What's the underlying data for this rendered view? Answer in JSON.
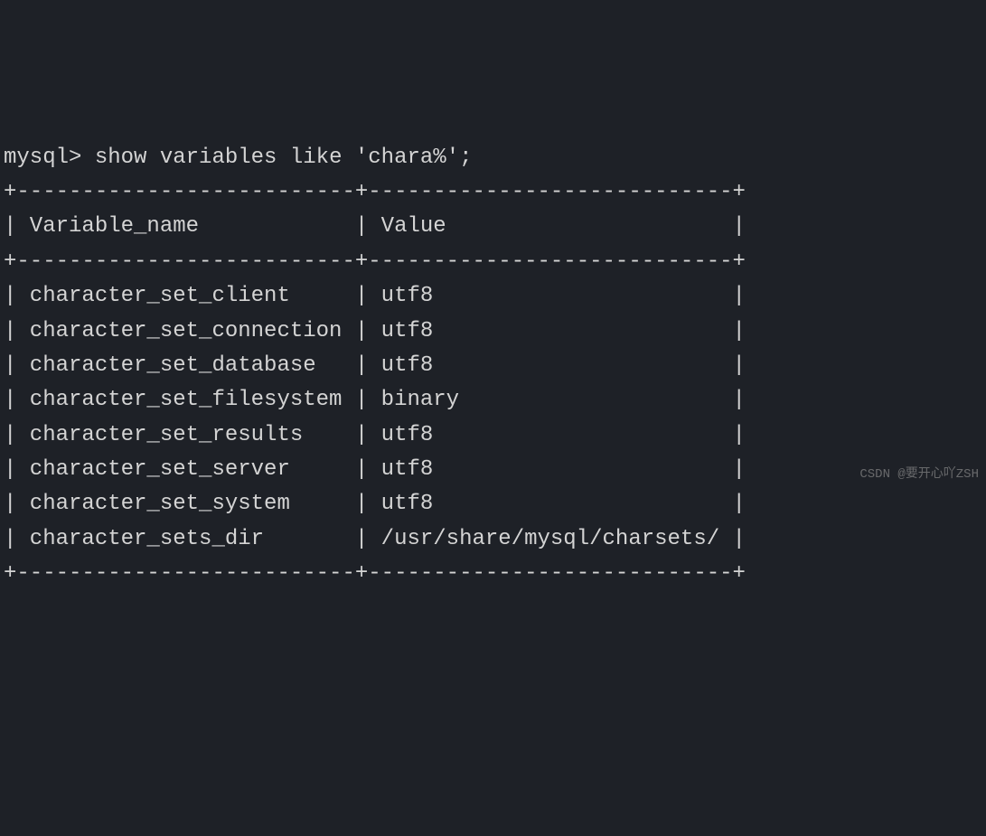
{
  "prompt": "mysql>",
  "command": "show variables like 'chara%';",
  "border_top": "+--------------------------+----------------------------+",
  "header_row": "| Variable_name            | Value                      |",
  "border_mid": "+--------------------------+----------------------------+",
  "rows": [
    "| character_set_client     | utf8                       |",
    "| character_set_connection | utf8                       |",
    "| character_set_database   | utf8                       |",
    "| character_set_filesystem | binary                     |",
    "| character_set_results    | utf8                       |",
    "| character_set_server     | utf8                       |",
    "| character_set_system     | utf8                       |",
    "| character_sets_dir       | /usr/share/mysql/charsets/ |"
  ],
  "border_bottom": "+--------------------------+----------------------------+",
  "table_data": {
    "columns": [
      "Variable_name",
      "Value"
    ],
    "data": [
      [
        "character_set_client",
        "utf8"
      ],
      [
        "character_set_connection",
        "utf8"
      ],
      [
        "character_set_database",
        "utf8"
      ],
      [
        "character_set_filesystem",
        "binary"
      ],
      [
        "character_set_results",
        "utf8"
      ],
      [
        "character_set_server",
        "utf8"
      ],
      [
        "character_set_system",
        "utf8"
      ],
      [
        "character_sets_dir",
        "/usr/share/mysql/charsets/"
      ]
    ]
  },
  "watermark": "CSDN @要开心吖ZSH"
}
